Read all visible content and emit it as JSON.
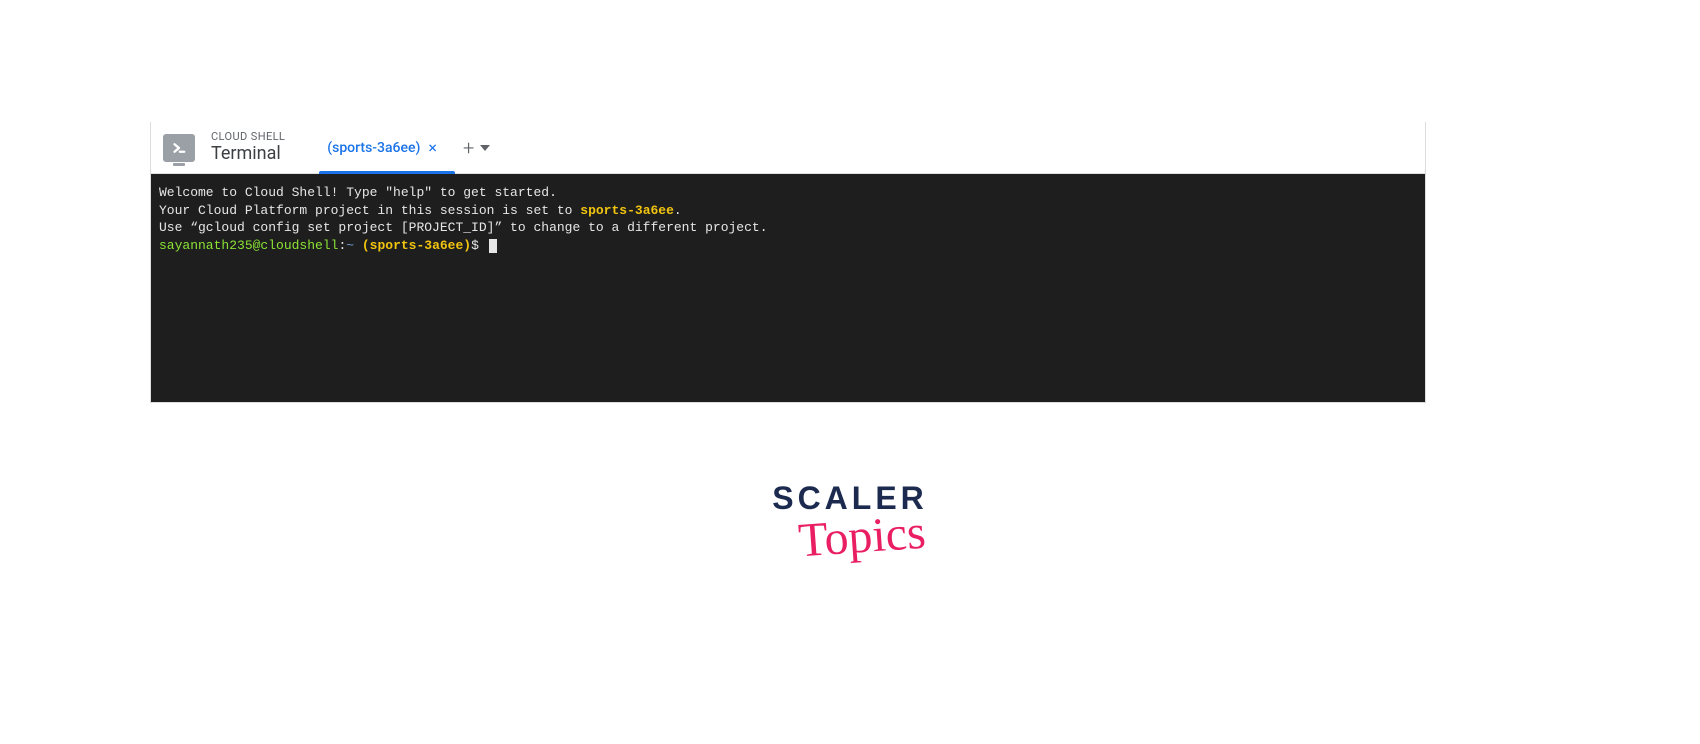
{
  "header": {
    "small_title": "CLOUD SHELL",
    "large_title": "Terminal"
  },
  "tab": {
    "label": "(sports-3a6ee)",
    "close_glyph": "×"
  },
  "add": {
    "plus": "+"
  },
  "terminal": {
    "line1": "Welcome to Cloud Shell! Type \"help\" to get started.",
    "line2a": "Your Cloud Platform project in this session is set to ",
    "line2b": "sports-3a6ee",
    "line2c": ".",
    "line3": "Use “gcloud config set project [PROJECT_ID]” to change to a different project.",
    "prompt_user": "sayannath235@cloudshell",
    "prompt_sep": ":",
    "prompt_path": "~",
    "prompt_project": " (sports-3a6ee)",
    "prompt_dollar": "$"
  },
  "watermark": {
    "line1": "SCALER",
    "line2": "Topics"
  }
}
